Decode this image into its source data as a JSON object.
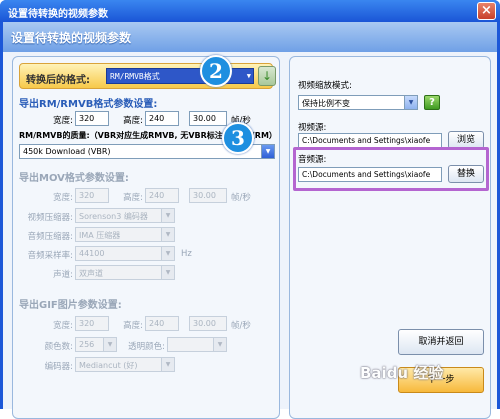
{
  "window": {
    "title": "设置待转换的视频参数",
    "header": "设置待转换的视频参数",
    "close_label": "×"
  },
  "format": {
    "label": "转换后的格式:",
    "value": "RM/RMVB格式"
  },
  "rm_section": {
    "title": "导出RM/RMVB格式参数设置:",
    "width_label": "宽度:",
    "width_value": "320",
    "height_label": "高度:",
    "height_value": "240",
    "fps_value": "30.00",
    "fps_unit": "帧/秒",
    "quality_label": "RM/RMVB的质量:（VBR对应生成RMVB, 无VBR标注选项对应RM）",
    "quality_value": "450k Download (VBR)"
  },
  "mov_section": {
    "title": "导出MOV格式参数设置:",
    "width_label": "宽度:",
    "width_value": "320",
    "height_label": "高度:",
    "height_value": "240",
    "fps_value": "30.00",
    "fps_unit": "帧/秒",
    "video_codec_label": "视频压缩器:",
    "video_codec_value": "Sorenson3 编码器",
    "audio_codec_label": "音频压缩器:",
    "audio_codec_value": "IMA 压缩器",
    "sample_rate_label": "音频采样率:",
    "sample_rate_value": "44100",
    "sample_rate_unit": "Hz",
    "channel_label": "声道:",
    "channel_value": "双声道"
  },
  "gif_section": {
    "title": "导出GIF图片参数设置:",
    "width_label": "宽度:",
    "width_value": "320",
    "height_label": "高度:",
    "height_value": "240",
    "fps_value": "30.00",
    "fps_unit": "帧/秒",
    "colors_label": "颜色数:",
    "colors_value": "256",
    "transparent_label": "透明颜色:",
    "encoder_label": "编码器:",
    "encoder_value": "Mediancut (好)"
  },
  "right": {
    "scale_label": "视频缩放模式:",
    "scale_value": "保持比例不变",
    "help_label": "?",
    "video_src_label": "视频源:",
    "video_src_value": "C:\\Documents and Settings\\xiaofe",
    "browse_label": "浏览",
    "audio_src_label": "音频源:",
    "audio_src_value": "C:\\Documents and Settings\\xiaofe",
    "replace_label": "替换",
    "cancel_label": "取消并返回",
    "next_label": "下一步"
  },
  "badges": {
    "two": "2",
    "three": "3"
  },
  "watermark": "Baidu 经验"
}
